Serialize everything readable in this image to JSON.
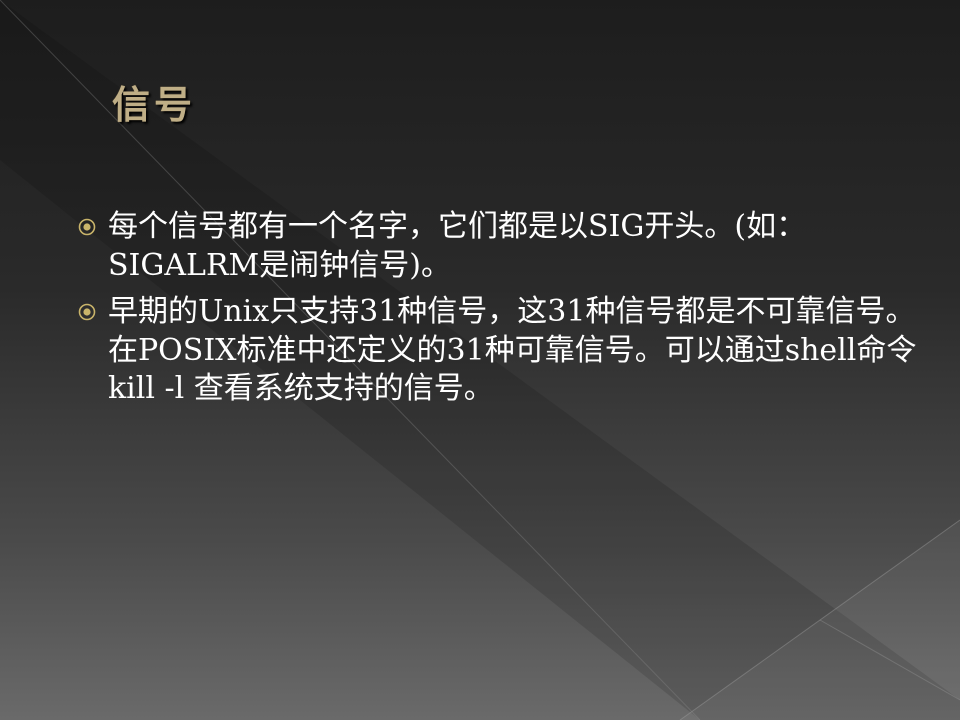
{
  "slide": {
    "title": "信号",
    "bullets": [
      {
        "icon": "bullet-circle-icon",
        "text": "每个信号都有一个名字，它们都是以SIG开头。(如：SIGALRM是闹钟信号)。"
      },
      {
        "icon": "bullet-circle-icon",
        "text": "早期的Unix只支持31种信号，这31种信号都是不可靠信号。在POSIX标准中还定义的31种可靠信号。可以通过shell命令kill -l 查看系统支持的信号。"
      }
    ]
  },
  "colors": {
    "title": "#bfae86",
    "bullet_icon": "#c9b46a",
    "text": "#ffffff"
  }
}
